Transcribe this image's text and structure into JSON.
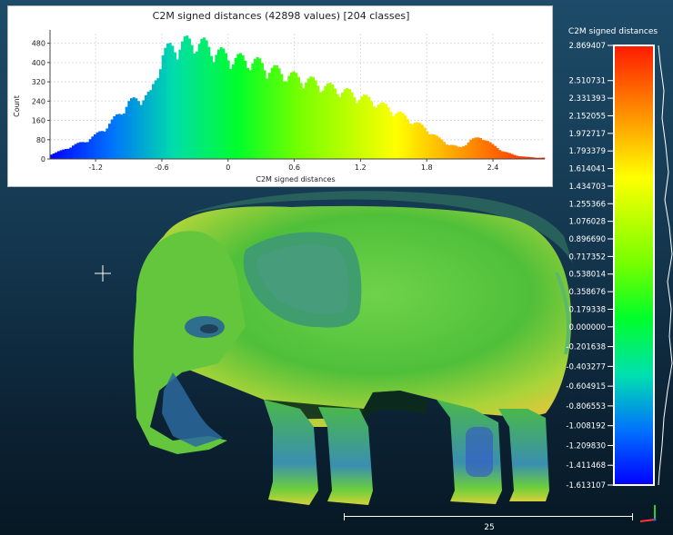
{
  "histogram": {
    "title": "C2M signed distances (42898 values)  [204 classes]",
    "ylabel": "Count",
    "xlabel": "C2M signed distances"
  },
  "color_scale": {
    "title": "C2M signed distances",
    "labels": [
      "2.869407",
      "2.510731",
      "2.331393",
      "2.152055",
      "1.972717",
      "1.793379",
      "1.614041",
      "1.434703",
      "1.255366",
      "1.076028",
      "0.896690",
      "0.717352",
      "0.538014",
      "0.358676",
      "0.179338",
      "0.000000",
      "-0.201638",
      "-0.403277",
      "-0.604915",
      "-0.806553",
      "-1.008192",
      "-1.209830",
      "-1.411468",
      "-1.613107"
    ]
  },
  "scale_bar": {
    "label": "25"
  },
  "chart_data": {
    "type": "bar",
    "title": "C2M signed distances (42898 values)  [204 classes]",
    "xlabel": "C2M signed distances",
    "ylabel": "Count",
    "xlim": [
      -1.613107,
      2.869407
    ],
    "ylim": [
      0,
      520
    ],
    "xticks": [
      -1.2,
      -0.6,
      0,
      0.6,
      1.2,
      1.8,
      2.4
    ],
    "yticks": [
      0,
      80,
      160,
      240,
      320,
      400,
      480
    ],
    "grid": true,
    "bins_x": [
      -1.6,
      -1.5,
      -1.4,
      -1.3,
      -1.2,
      -1.1,
      -1.0,
      -0.9,
      -0.8,
      -0.7,
      -0.65,
      -0.6,
      -0.5,
      -0.4,
      -0.3,
      -0.2,
      -0.1,
      0.0,
      0.1,
      0.2,
      0.3,
      0.4,
      0.5,
      0.6,
      0.7,
      0.8,
      0.9,
      1.0,
      1.1,
      1.2,
      1.3,
      1.4,
      1.5,
      1.6,
      1.7,
      1.8,
      1.9,
      2.0,
      2.1,
      2.2,
      2.3,
      2.4,
      2.5,
      2.6,
      2.7,
      2.8
    ],
    "values": [
      20,
      35,
      55,
      70,
      95,
      130,
      175,
      225,
      245,
      260,
      330,
      420,
      450,
      465,
      470,
      455,
      430,
      410,
      400,
      395,
      380,
      360,
      345,
      330,
      320,
      305,
      290,
      280,
      265,
      250,
      235,
      215,
      195,
      170,
      145,
      120,
      85,
      60,
      45,
      75,
      90,
      55,
      30,
      15,
      8,
      5
    ]
  }
}
